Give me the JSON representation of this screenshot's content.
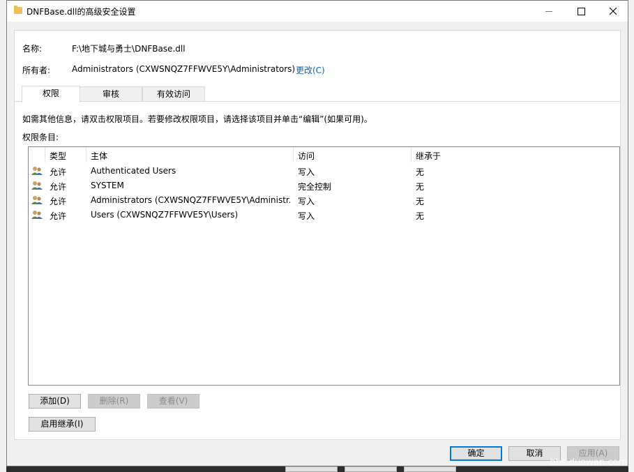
{
  "window": {
    "title": "DNFBase.dll的高级安全设置"
  },
  "info": {
    "name_label": "名称:",
    "name_value": "F:\\地下城与勇士\\DNFBase.dll",
    "owner_label": "所有者:",
    "owner_value": "Administrators (CXWSNQZ7FFWVE5Y\\Administrators)",
    "change_link": "更改(C)"
  },
  "tabs": [
    {
      "label": "权限",
      "active": true
    },
    {
      "label": "审核",
      "active": false
    },
    {
      "label": "有效访问",
      "active": false
    }
  ],
  "instructions": "如需其他信息，请双击权限项目。若要修改权限项目，请选择该项目并单击“编辑”(如果可用)。",
  "entries_label": "权限条目:",
  "table": {
    "columns": [
      "类型",
      "主体",
      "访问",
      "继承于"
    ],
    "rows": [
      {
        "type": "允许",
        "principal": "Authenticated Users",
        "access": "写入",
        "inherited": "无"
      },
      {
        "type": "允许",
        "principal": "SYSTEM",
        "access": "完全控制",
        "inherited": "无"
      },
      {
        "type": "允许",
        "principal": "Administrators (CXWSNQZ7FFWVE5Y\\Administr...",
        "access": "写入",
        "inherited": "无"
      },
      {
        "type": "允许",
        "principal": "Users (CXWSNQZ7FFWVE5Y\\Users)",
        "access": "写入",
        "inherited": "无"
      }
    ]
  },
  "buttons": {
    "add": "添加(D)",
    "remove": "删除(R)",
    "view": "查看(V)",
    "enable_inheritance": "启用继承(I)",
    "ok": "确定",
    "cancel": "取消",
    "apply": "应用(A)"
  },
  "watermark": "bbs.duowan.com"
}
